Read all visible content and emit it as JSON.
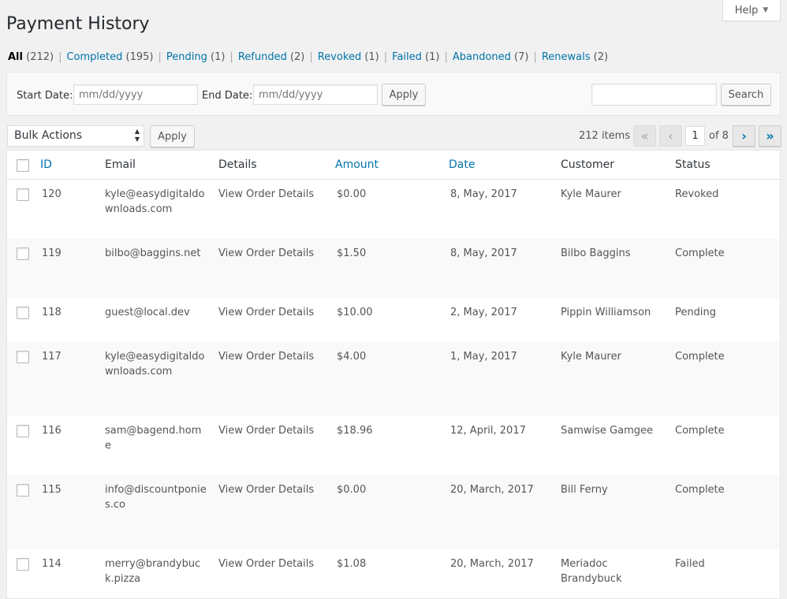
{
  "help_label": "Help",
  "page_title": "Payment History",
  "status_filters": [
    {
      "label": "All",
      "count": "(212)"
    },
    {
      "label": "Completed",
      "count": "(195)"
    },
    {
      "label": "Pending",
      "count": "(1)"
    },
    {
      "label": "Refunded",
      "count": "(2)"
    },
    {
      "label": "Revoked",
      "count": "(1)"
    },
    {
      "label": "Failed",
      "count": "(1)"
    },
    {
      "label": "Abandoned",
      "count": "(7)"
    },
    {
      "label": "Renewals",
      "count": "(2)"
    }
  ],
  "filters": {
    "start_label": "Start Date:",
    "start_placeholder": "mm/dd/yyyy",
    "end_label": "End Date:",
    "end_placeholder": "mm/dd/yyyy",
    "apply_label": "Apply",
    "search_label": "Search"
  },
  "bulk": {
    "selected": "Bulk Actions",
    "apply_label": "Apply"
  },
  "pagination": {
    "items": "212 items",
    "first": "«",
    "prev": "‹",
    "current_page": "1",
    "of": "of 8",
    "next": "›",
    "last": "»"
  },
  "columns": {
    "id": "ID",
    "email": "Email",
    "details": "Details",
    "amount": "Amount",
    "date": "Date",
    "customer": "Customer",
    "status": "Status"
  },
  "rows": [
    {
      "id": "120",
      "email": "kyle@easydigitaldownloads.com",
      "details": "View Order Details",
      "amount": "$0.00",
      "date": "8, May, 2017",
      "customer": "Kyle Maurer",
      "status": "Revoked"
    },
    {
      "id": "119",
      "email": "bilbo@baggins.net",
      "details": "View Order Details",
      "amount": "$1.50",
      "date": "8, May, 2017",
      "customer": "Bilbo Baggins",
      "status": "Complete"
    },
    {
      "id": "118",
      "email": "guest@local.dev",
      "details": "View Order Details",
      "amount": "$10.00",
      "date": "2, May, 2017",
      "customer": "Pippin Williamson",
      "status": "Pending"
    },
    {
      "id": "117",
      "email": "kyle@easydigitaldownloads.com",
      "details": "View Order Details",
      "amount": "$4.00",
      "date": "1, May, 2017",
      "customer": "Kyle Maurer",
      "status": "Complete"
    },
    {
      "id": "116",
      "email": "sam@bagend.home",
      "details": "View Order Details",
      "amount": "$18.96",
      "date": "12, April, 2017",
      "customer": "Samwise Gamgee",
      "status": "Complete"
    },
    {
      "id": "115",
      "email": "info@discountponies.co",
      "details": "View Order Details",
      "amount": "$0.00",
      "date": "20, March, 2017",
      "customer": "Bill Ferny",
      "status": "Complete"
    },
    {
      "id": "114",
      "email": "merry@brandybuck.pizza",
      "details": "View Order Details",
      "amount": "$1.08",
      "date": "20, March, 2017",
      "customer": "Meriadoc Brandybuck",
      "status": "Failed"
    }
  ]
}
